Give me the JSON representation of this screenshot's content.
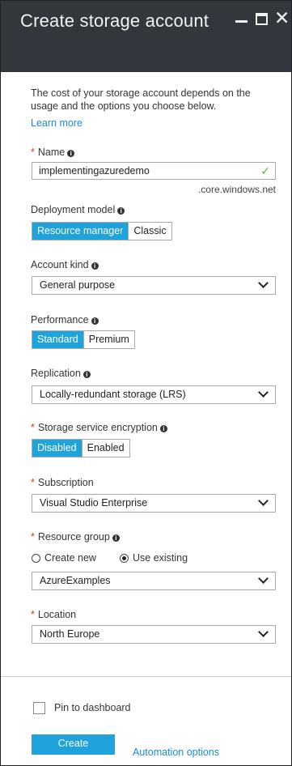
{
  "window": {
    "title": "Create storage account",
    "minimize_glyph": "_",
    "close_glyph": "✕"
  },
  "intro": {
    "description": "The cost of your storage account depends on the usage and the options you choose below.",
    "learn_more": "Learn more"
  },
  "name": {
    "label": "Name",
    "required": "*",
    "value": "implementingazuredemo",
    "valid_icon": "checkmark-icon",
    "suffix": ".core.windows.net"
  },
  "deployment_model": {
    "label": "Deployment model",
    "options": [
      "Resource manager",
      "Classic"
    ],
    "selected": "Resource manager"
  },
  "account_kind": {
    "label": "Account kind",
    "value": "General purpose"
  },
  "performance": {
    "label": "Performance",
    "options": [
      "Standard",
      "Premium"
    ],
    "selected": "Standard"
  },
  "replication": {
    "label": "Replication",
    "value": "Locally-redundant storage (LRS)"
  },
  "encryption": {
    "label": "Storage service encryption",
    "required": "*",
    "options": [
      "Disabled",
      "Enabled"
    ],
    "selected": "Disabled"
  },
  "subscription": {
    "label": "Subscription",
    "required": "*",
    "value": "Visual Studio Enterprise"
  },
  "resource_group": {
    "label": "Resource group",
    "required": "*",
    "radio_create": "Create new",
    "radio_existing": "Use existing",
    "selected_radio": "Use existing",
    "value": "AzureExamples"
  },
  "location": {
    "label": "Location",
    "required": "*",
    "value": "North Europe"
  },
  "footer": {
    "pin_label": "Pin to dashboard",
    "pin_checked": false,
    "create_label": "Create",
    "automation_label": "Automation options"
  },
  "colors": {
    "accent": "#1fa3dd",
    "link": "#1a8ad2",
    "required": "#d9362b",
    "titlebar": "#32373d",
    "valid": "#5fb22a"
  },
  "info_glyph": "i",
  "chevron_icon": "chevron-down-icon"
}
